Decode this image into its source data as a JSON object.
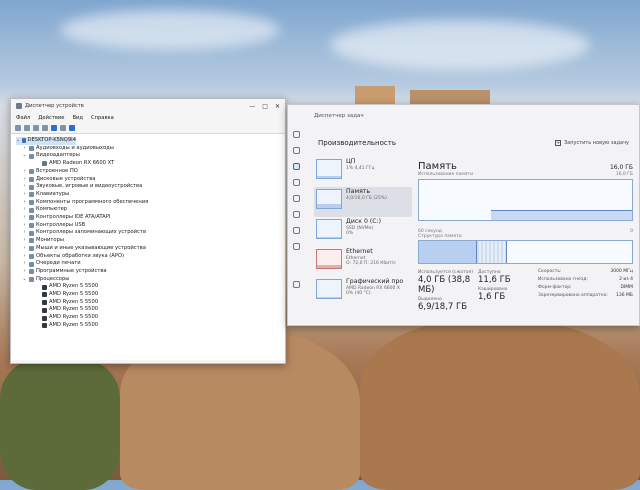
{
  "colors": {
    "accent": "#2c66c8",
    "memory_graph": "#5b86c9",
    "ethernet_graph": "#c77777"
  },
  "device_manager": {
    "title": "Диспетчер устройств",
    "controls": [
      "—",
      "□",
      "✕"
    ],
    "menu": [
      "Файл",
      "Действие",
      "Вид",
      "Справка"
    ],
    "tree": {
      "root": "DESKTOP-K5NQ9I4",
      "items": [
        {
          "label": "Аудиовходы и аудиовыходы",
          "expanded": false
        },
        {
          "label": "Видеоадаптеры",
          "expanded": true,
          "children": [
            "AMD Radeon RX 6600 XT"
          ]
        },
        {
          "label": "Встроенное ПО",
          "expanded": false
        },
        {
          "label": "Дисковые устройства",
          "expanded": false
        },
        {
          "label": "Звуковые, игровые и видеоустройства",
          "expanded": false
        },
        {
          "label": "Клавиатуры",
          "expanded": false
        },
        {
          "label": "Компоненты программного обеспечения",
          "expanded": false
        },
        {
          "label": "Компьютер",
          "expanded": false
        },
        {
          "label": "Контроллеры IDE ATA/ATAPI",
          "expanded": false
        },
        {
          "label": "Контроллеры USB",
          "expanded": false
        },
        {
          "label": "Контроллеры запоминающих устройств",
          "expanded": false
        },
        {
          "label": "Мониторы",
          "expanded": false
        },
        {
          "label": "Мыши и иные указывающие устройства",
          "expanded": false
        },
        {
          "label": "Объекты обработки звука (APO)",
          "expanded": false
        },
        {
          "label": "Очереди печати",
          "expanded": false
        },
        {
          "label": "Программные устройства",
          "expanded": false
        },
        {
          "label": "Процессоры",
          "expanded": true,
          "children": [
            "AMD Ryzen 5 5500",
            "AMD Ryzen 5 5500",
            "AMD Ryzen 5 5500",
            "AMD Ryzen 5 5500",
            "AMD Ryzen 5 5500",
            "AMD Ryzen 5 5500"
          ]
        }
      ]
    }
  },
  "task_manager": {
    "title": "Диспетчер задач",
    "section": "Производительность",
    "run_task": "Запустить новую задачу",
    "perf_items": [
      {
        "name": "ЦП",
        "sub": "1% 4,41 ГГц",
        "fill": 0.1
      },
      {
        "name": "Память",
        "sub": "4,0/16,0 ГБ (25%)",
        "fill": 0.25
      },
      {
        "name": "Диск 0 (C:)",
        "sub": "SSD (NVMe)",
        "sub2": "0%",
        "fill": 0.05
      },
      {
        "name": "Ethernet",
        "sub": "Ethernet",
        "sub2": "О: 72,0 П: 216 Кбит/с",
        "fill": 0.15
      },
      {
        "name": "Графический про",
        "sub": "AMD Radeon RX 6600 X",
        "sub2": "0% (40 °C)",
        "fill": 0.05
      }
    ],
    "memory": {
      "title": "Память",
      "total": "16,0 ГБ",
      "graph_label": "Использование памяти",
      "graph_max": "16,0 ГБ",
      "graph_time": "60 секунд",
      "graph_min": "0",
      "usage_fraction": 0.25,
      "composition_label": "Структура памяти",
      "stats": {
        "in_use_label": "Используется (сжатая)",
        "in_use": "4,0 ГБ (38,8 МБ)",
        "available_label": "Доступно",
        "available": "11,6 ГБ",
        "committed_label": "Выделено",
        "committed": "6,9/18,7 ГБ",
        "cached_label": "Кэшировано",
        "cached": "1,6 ГБ"
      },
      "props": [
        {
          "k": "Скорость:",
          "v": "3000 МГц"
        },
        {
          "k": "Использовано гнезд:",
          "v": "2 из 4"
        },
        {
          "k": "Форм-фактор:",
          "v": "DIMM"
        },
        {
          "k": "Зарезервировано аппаратно:",
          "v": "136 МБ"
        }
      ]
    }
  }
}
